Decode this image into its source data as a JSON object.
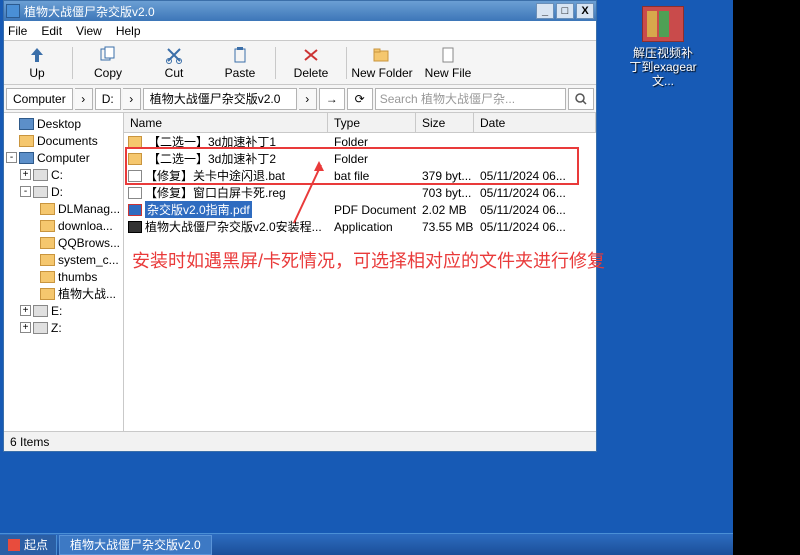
{
  "desktop_icon": {
    "label": "解压视频补丁到exagear文..."
  },
  "window": {
    "title": "植物大战僵尸杂交版v2.0",
    "menu": [
      "File",
      "Edit",
      "View",
      "Help"
    ],
    "toolbar": {
      "up": "Up",
      "copy": "Copy",
      "cut": "Cut",
      "paste": "Paste",
      "delete": "Delete",
      "newfolder": "New Folder",
      "newfile": "New File"
    },
    "path": {
      "root": "Computer",
      "drive": "D:",
      "folder": "植物大战僵尸杂交版v2.0"
    },
    "search_placeholder": "Search 植物大战僵尸杂...",
    "tree": {
      "desktop": "Desktop",
      "documents": "Documents",
      "computer": "Computer",
      "c": "C:",
      "d": "D:",
      "d_children": [
        "DLManag...",
        "downloa...",
        "QQBrows...",
        "system_c...",
        "thumbs",
        "植物大战..."
      ],
      "e": "E:",
      "z": "Z:"
    },
    "columns": {
      "name": "Name",
      "type": "Type",
      "size": "Size",
      "date": "Date"
    },
    "rows": [
      {
        "icon": "fold",
        "name": "【二选一】3d加速补丁1",
        "type": "Folder",
        "size": "",
        "date": ""
      },
      {
        "icon": "fold",
        "name": "【二选一】3d加速补丁2",
        "type": "Folder",
        "size": "",
        "date": ""
      },
      {
        "icon": "file",
        "name": "【修复】关卡中途闪退.bat",
        "type": "bat file",
        "size": "379 byt...",
        "date": "05/11/2024 06..."
      },
      {
        "icon": "file",
        "name": "【修复】窗口白屏卡死.reg",
        "type": "",
        "size": "703 byt...",
        "date": "05/11/2024 06..."
      },
      {
        "icon": "pdf",
        "name": "杂交版v2.0指南.pdf",
        "type": "PDF Document",
        "size": "2.02 MB",
        "date": "05/11/2024 06...",
        "selected": true
      },
      {
        "icon": "app",
        "name": "植物大战僵尸杂交版v2.0安装程...",
        "type": "Application",
        "size": "73.55 MB",
        "date": "05/11/2024 06..."
      }
    ],
    "status": "6 Items"
  },
  "annotation": "安装时如遇黑屏/卡死情况，可选择相对应的文件夹进行修复",
  "taskbar": {
    "start": "起点",
    "task": "植物大战僵尸杂交版v2.0"
  }
}
